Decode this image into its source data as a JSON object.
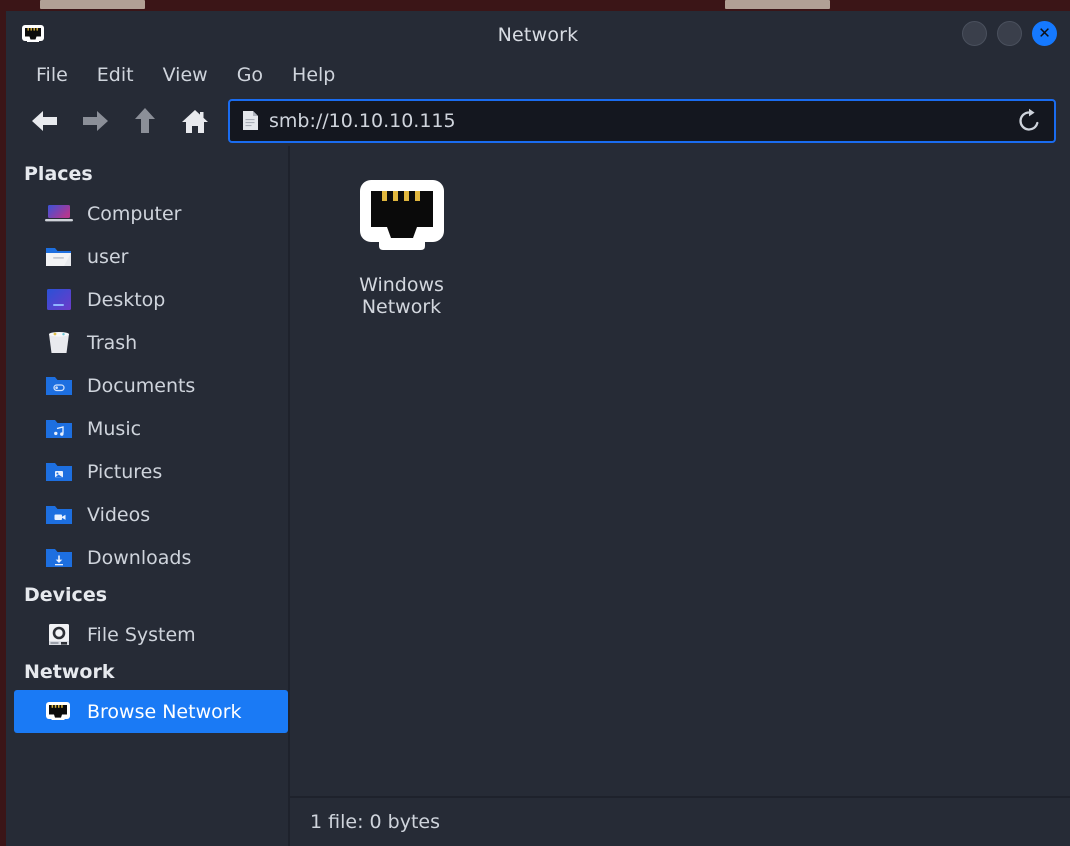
{
  "window": {
    "title": "Network",
    "title_icon": "network-port-icon",
    "controls": [
      {
        "name": "minimize-button",
        "label": ""
      },
      {
        "name": "maximize-button",
        "label": ""
      },
      {
        "name": "close-button",
        "label": "✕"
      }
    ],
    "accent_color": "#1a7af5",
    "close_color": "#1579ff",
    "background_color": "#262b36",
    "desktop_color": "#3b1517"
  },
  "menubar": {
    "items": [
      {
        "label": "File"
      },
      {
        "label": "Edit"
      },
      {
        "label": "View"
      },
      {
        "label": "Go"
      },
      {
        "label": "Help"
      }
    ]
  },
  "toolbar": {
    "back": {
      "icon": "arrow-left-icon",
      "enabled": true
    },
    "forward": {
      "icon": "arrow-right-icon",
      "enabled": false
    },
    "up": {
      "icon": "arrow-up-icon",
      "enabled": false
    },
    "home": {
      "icon": "home-icon",
      "enabled": true
    },
    "path": {
      "icon": "document-icon",
      "value": "smb://10.10.10.115",
      "placeholder": "Location"
    },
    "reload": {
      "icon": "reload-icon",
      "label": ""
    }
  },
  "sidebar": {
    "sections": [
      {
        "header": "Places",
        "items": [
          {
            "label": "Computer",
            "icon": "computer-icon",
            "selected": false
          },
          {
            "label": "user",
            "icon": "home-folder-icon",
            "selected": false
          },
          {
            "label": "Desktop",
            "icon": "desktop-icon",
            "selected": false
          },
          {
            "label": "Trash",
            "icon": "trash-icon",
            "selected": false
          },
          {
            "label": "Documents",
            "icon": "documents-folder-icon",
            "selected": false
          },
          {
            "label": "Music",
            "icon": "music-folder-icon",
            "selected": false
          },
          {
            "label": "Pictures",
            "icon": "pictures-folder-icon",
            "selected": false
          },
          {
            "label": "Videos",
            "icon": "videos-folder-icon",
            "selected": false
          },
          {
            "label": "Downloads",
            "icon": "downloads-folder-icon",
            "selected": false
          }
        ]
      },
      {
        "header": "Devices",
        "items": [
          {
            "label": "File System",
            "icon": "harddisk-icon",
            "selected": false
          }
        ]
      },
      {
        "header": "Network",
        "items": [
          {
            "label": "Browse Network",
            "icon": "network-port-icon",
            "selected": true
          }
        ]
      }
    ]
  },
  "main": {
    "files": [
      {
        "label": "Windows Network",
        "icon": "network-port-icon"
      }
    ]
  },
  "statusbar": {
    "text": "1 file: 0 bytes"
  }
}
